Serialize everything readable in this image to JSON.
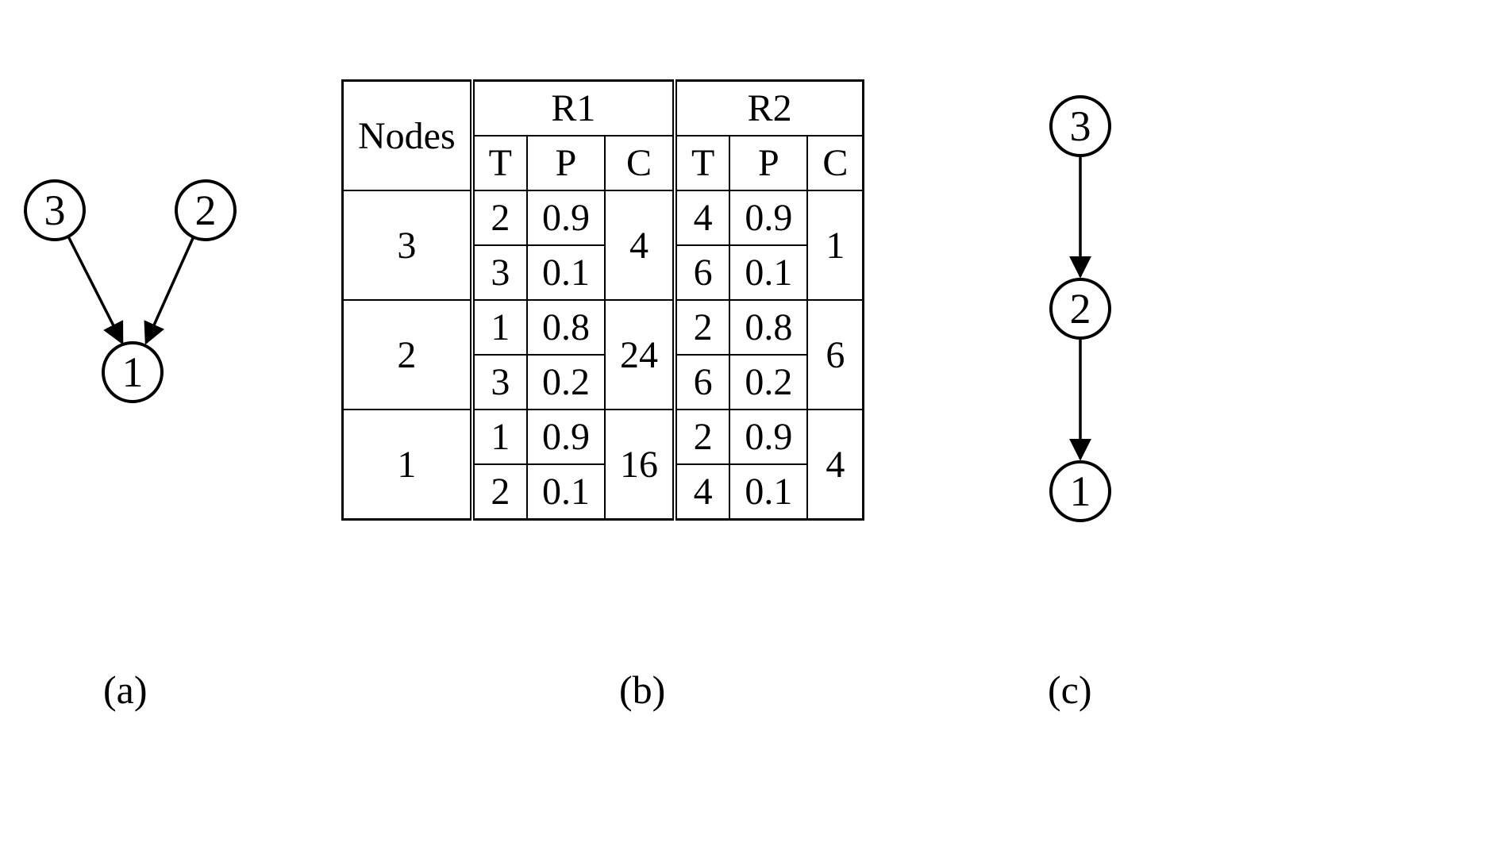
{
  "graph_a": {
    "nodes": {
      "n3": "3",
      "n2": "2",
      "n1": "1"
    },
    "edges": [
      {
        "from": "3",
        "to": "1"
      },
      {
        "from": "2",
        "to": "1"
      }
    ]
  },
  "table": {
    "header_nodes": "Nodes",
    "group_R1": "R1",
    "group_R2": "R2",
    "sub_T": "T",
    "sub_P": "P",
    "sub_C": "C",
    "rows": [
      {
        "node": "3",
        "R1": {
          "T": [
            "2",
            "3"
          ],
          "P": [
            "0.9",
            "0.1"
          ],
          "C": "4"
        },
        "R2": {
          "T": [
            "4",
            "6"
          ],
          "P": [
            "0.9",
            "0.1"
          ],
          "C": "1"
        }
      },
      {
        "node": "2",
        "R1": {
          "T": [
            "1",
            "3"
          ],
          "P": [
            "0.8",
            "0.2"
          ],
          "C": "24"
        },
        "R2": {
          "T": [
            "2",
            "6"
          ],
          "P": [
            "0.8",
            "0.2"
          ],
          "C": "6"
        }
      },
      {
        "node": "1",
        "R1": {
          "T": [
            "1",
            "2"
          ],
          "P": [
            "0.9",
            "0.1"
          ],
          "C": "16"
        },
        "R2": {
          "T": [
            "2",
            "4"
          ],
          "P": [
            "0.9",
            "0.1"
          ],
          "C": "4"
        }
      }
    ]
  },
  "graph_c": {
    "nodes": {
      "n3": "3",
      "n2": "2",
      "n1": "1"
    },
    "edges": [
      {
        "from": "3",
        "to": "2"
      },
      {
        "from": "2",
        "to": "1"
      }
    ]
  },
  "captions": {
    "a": "(a)",
    "b": "(b)",
    "c": "(c)"
  }
}
